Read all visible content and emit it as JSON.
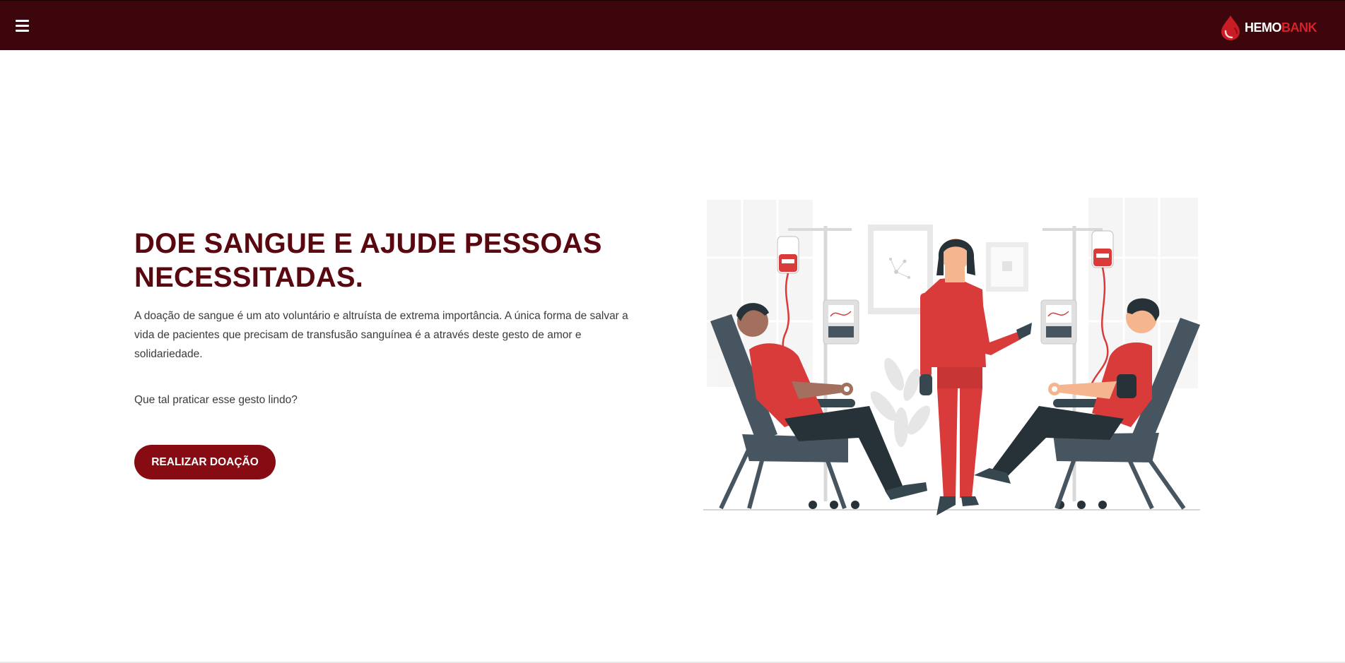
{
  "header": {
    "menu_icon": "hamburger-menu-icon",
    "logo_icon": "blood-drop-icon",
    "logo_part1": "HEMO",
    "logo_part2": "BANK",
    "background_color": "#3c060c"
  },
  "hero": {
    "title": "DOE SANGUE E AJUDE PESSOAS NECESSITADAS.",
    "description": "A doação de sangue é um ato voluntário e altruísta de extrema importância. A única forma de salvar a vida de pacientes que precisam de transfusão sanguínea é a através deste gesto de amor e solidariedade.",
    "question": "Que tal praticar esse gesto lindo?",
    "cta_label": "REALIZAR DOAÇÃO",
    "title_color": "#5a0810",
    "button_color": "#870b13"
  },
  "illustration": {
    "subject": "blood-donation-illustration",
    "accent_color": "#d93b3b",
    "chair_color": "#475560"
  }
}
